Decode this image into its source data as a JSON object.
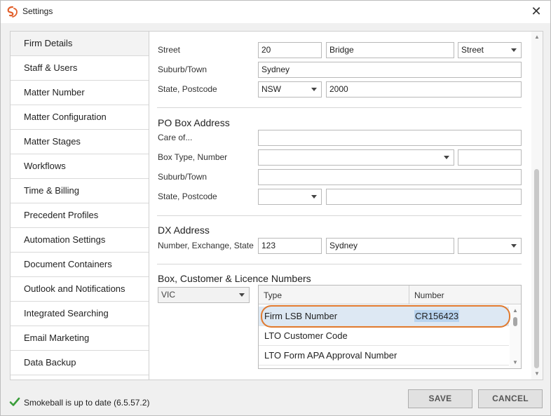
{
  "window": {
    "title": "Settings",
    "close_glyph": "✕"
  },
  "sidebar": {
    "items": [
      {
        "label": "Firm Details"
      },
      {
        "label": "Staff & Users"
      },
      {
        "label": "Matter Number"
      },
      {
        "label": "Matter Configuration"
      },
      {
        "label": "Matter Stages"
      },
      {
        "label": "Workflows"
      },
      {
        "label": "Time & Billing"
      },
      {
        "label": "Precedent Profiles"
      },
      {
        "label": "Automation Settings"
      },
      {
        "label": "Document Containers"
      },
      {
        "label": "Outlook and Notifications"
      },
      {
        "label": "Integrated Searching"
      },
      {
        "label": "Email Marketing"
      },
      {
        "label": "Data Backup"
      }
    ]
  },
  "street_address": {
    "street_label": "Street",
    "street_number": "20",
    "street_name": "Bridge",
    "street_type": "Street",
    "suburb_label": "Suburb/Town",
    "suburb": "Sydney",
    "state_postcode_label": "State, Postcode",
    "state": "NSW",
    "postcode": "2000"
  },
  "po_box": {
    "title": "PO Box Address",
    "care_of_label": "Care of...",
    "care_of": "",
    "box_label": "Box Type, Number",
    "box_type": "",
    "box_number": "",
    "suburb_label": "Suburb/Town",
    "suburb": "",
    "state_postcode_label": "State, Postcode",
    "state": "",
    "postcode": ""
  },
  "dx": {
    "title": "DX Address",
    "label": "Number, Exchange, State",
    "number": "123",
    "exchange": "Sydney",
    "state": ""
  },
  "licence": {
    "title": "Box, Customer & Licence Numbers",
    "state_filter": "VIC",
    "columns": [
      "Type",
      "Number"
    ],
    "rows": [
      {
        "type": "Firm LSB Number",
        "number": "CR156423"
      },
      {
        "type": "LTO Customer Code",
        "number": ""
      },
      {
        "type": "LTO Form APA Approval Number",
        "number": ""
      }
    ]
  },
  "status": {
    "text": "Smokeball is up to date (6.5.57.2)"
  },
  "buttons": {
    "save": "SAVE",
    "cancel": "CANCEL"
  },
  "colors": {
    "highlight_outline": "#e07a2f",
    "selected_row": "#dde8f3",
    "check_green": "#3a9d3a",
    "logo_orange": "#e2602b"
  },
  "icons": {
    "logo": "smokeball-logo-icon",
    "check": "check-icon",
    "close": "close-icon",
    "dropdown": "chevron-down-icon"
  }
}
